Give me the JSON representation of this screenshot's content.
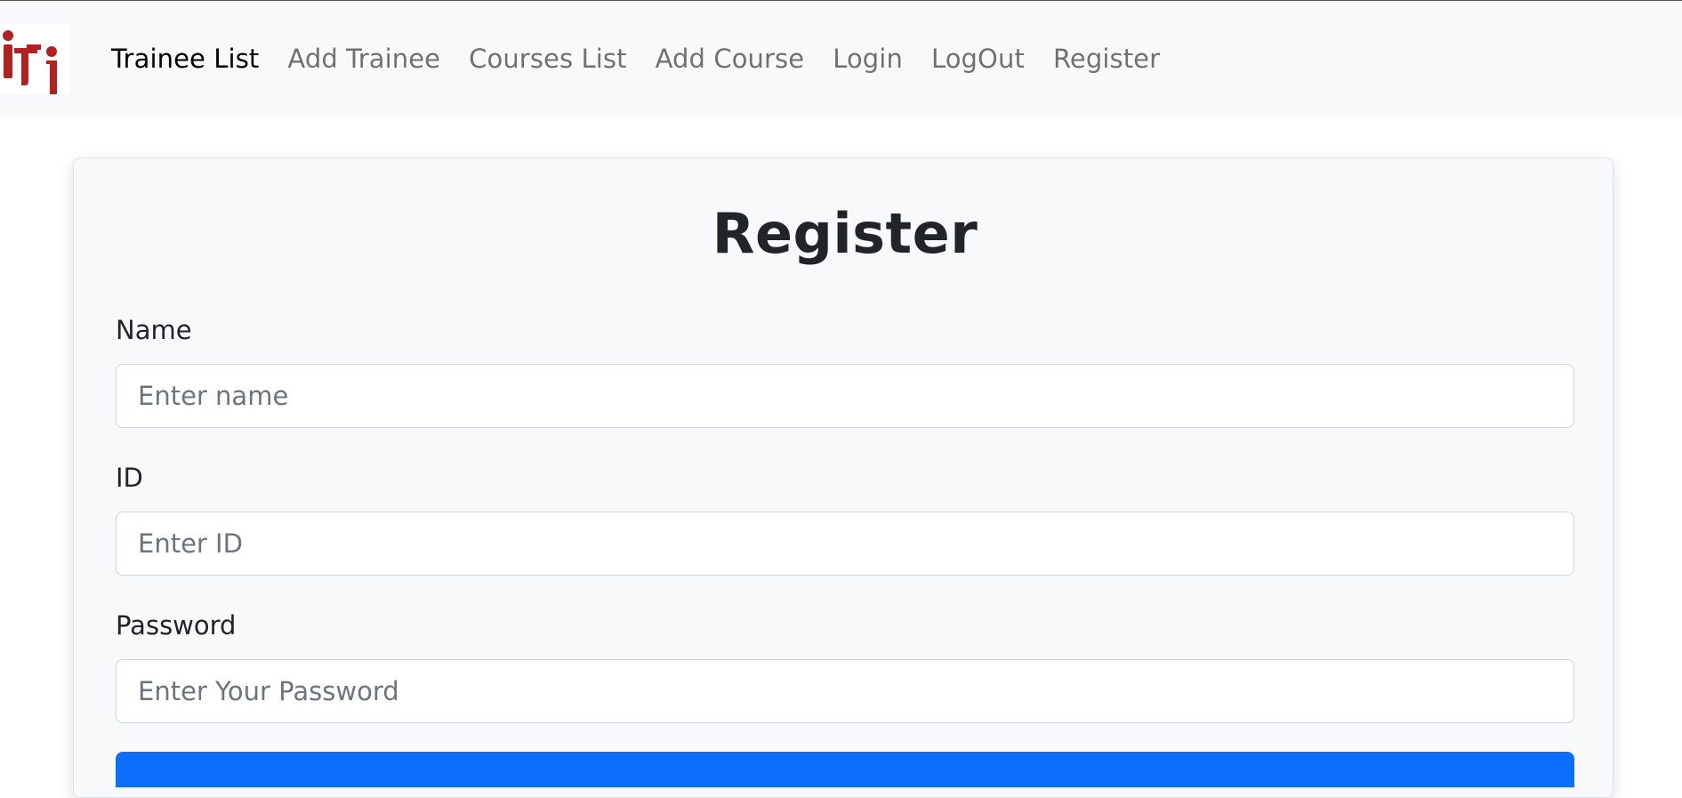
{
  "navbar": {
    "logo": "iti-logo",
    "links": [
      "Trainee List",
      "Add Trainee",
      "Courses List",
      "Add Course",
      "Login",
      "LogOut",
      "Register"
    ]
  },
  "form": {
    "title": "Register",
    "fields": [
      {
        "label": "Name",
        "placeholder": "Enter name"
      },
      {
        "label": "ID",
        "placeholder": "Enter ID"
      },
      {
        "label": "Password",
        "placeholder": "Enter Your Password"
      }
    ]
  },
  "colors": {
    "brand_red": "#b22222",
    "primary": "#0d6efd",
    "navbar_bg": "#f8f9fa"
  }
}
